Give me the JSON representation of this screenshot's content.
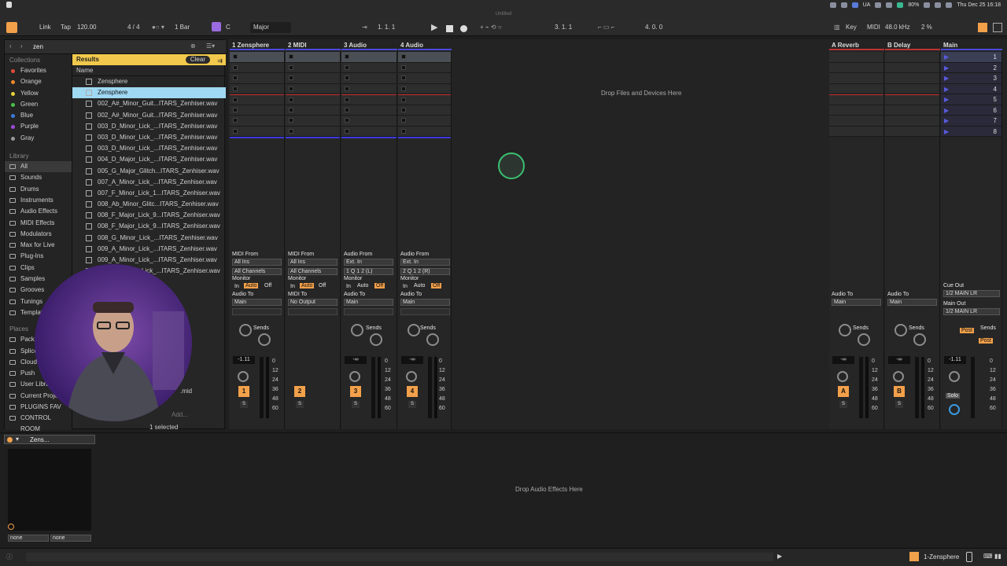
{
  "system": {
    "menubar_right": [
      "UA",
      "80%",
      "Thu Dec 25 16:18"
    ]
  },
  "window": {
    "title": "Untitled"
  },
  "transport": {
    "link": "Link",
    "tap": "Tap",
    "tempo": "120.00",
    "signature": "4 / 4",
    "quantize": "1 Bar",
    "key": "C",
    "scale": "Major",
    "position": "1.   1.   1",
    "loop_start": "3.   1.   1",
    "loop_length": "4.   0.   0",
    "key_label": "Key",
    "midi_label": "MIDI",
    "sample_rate": "48.0 kHz",
    "cpu": "2 %"
  },
  "browser": {
    "search_value": "zen",
    "collections_label": "Collections",
    "collections": [
      {
        "label": "Favorites",
        "color": "#e04a3a"
      },
      {
        "label": "Orange",
        "color": "#f08a2a"
      },
      {
        "label": "Yellow",
        "color": "#e8d23a"
      },
      {
        "label": "Green",
        "color": "#4ac04a"
      },
      {
        "label": "Blue",
        "color": "#3a7ae0"
      },
      {
        "label": "Purple",
        "color": "#a04ad8"
      },
      {
        "label": "Gray",
        "color": "#9a9a9a"
      }
    ],
    "library_label": "Library",
    "library": [
      "All",
      "Sounds",
      "Drums",
      "Instruments",
      "Audio Effects",
      "MIDI Effects",
      "Modulators",
      "Max for Live",
      "Plug-Ins",
      "Clips",
      "Samples",
      "Grooves",
      "Tunings",
      "Templates"
    ],
    "places_label": "Places",
    "places": [
      "Packs",
      "Splice",
      "Cloud",
      "Push",
      "User Library",
      "Current Project",
      "PLUGINS FAV",
      "CONTROL ROOM"
    ],
    "results_label": "Results",
    "clear_label": "Clear",
    "name_header": "Name",
    "results": [
      "Zensphere",
      "Zensphere",
      "002_A#_Minor_Guit...ITARS_Zenhiser.wav",
      "002_A#_Minor_Guit...ITARS_Zenhiser.wav",
      "003_D_Minor_Lick_...ITARS_Zenhiser.wav",
      "003_D_Minor_Lick_...ITARS_Zenhiser.wav",
      "003_D_Minor_Lick_...ITARS_Zenhiser.wav",
      "004_D_Major_Lick_...ITARS_Zenhiser.wav",
      "005_G_Major_Glitch...ITARS_Zenhiser.wav",
      "007_A_Minor_Lick_...ITARS_Zenhiser.wav",
      "007_F_Minor_Lick_1...ITARS_Zenhiser.wav",
      "008_Ab_Minor_Glitc...ITARS_Zenhiser.wav",
      "008_F_Major_Lick_9...ITARS_Zenhiser.wav",
      "008_F_Major_Lick_9...ITARS_Zenhiser.wav",
      "008_G_Minor_Lick_...ITARS_Zenhiser.wav",
      "009_A_Minor_Lick_...ITARS_Zenhiser.wav",
      "009_A_Minor_Lick_...ITARS_Zenhiser.wav",
      "009_F#_Minor_Lick_...ITARS_Zenhiser.wav"
    ],
    "footer_selected": "1 selected",
    "footer_add": "Add...",
    "mid_fragment": ".mid"
  },
  "tracks": [
    {
      "name": "1 Zensphere",
      "input_label": "MIDI From",
      "input": "All Ins",
      "channel": "All Channels",
      "out_label": "Audio To",
      "out": "Main",
      "num": "1",
      "vol": "-1.11",
      "sends_label": "Sends",
      "has_sends": true
    },
    {
      "name": "2 MIDI",
      "input_label": "MIDI From",
      "input": "All Ins",
      "channel": "All Channels",
      "out_label": "MIDI To",
      "out": "No Output",
      "num": "2",
      "vol": "",
      "sends_label": "",
      "has_sends": false
    },
    {
      "name": "3 Audio",
      "input_label": "Audio From",
      "input": "Ext. In",
      "channel": "1 Q 1 2 (L)",
      "out_label": "Audio To",
      "out": "Main",
      "num": "3",
      "vol": "-∞",
      "sends_label": "Sends",
      "has_sends": true
    },
    {
      "name": "4 Audio",
      "input_label": "Audio From",
      "input": "Ext. In",
      "channel": "2 Q 1 2 (R)",
      "out_label": "Audio To",
      "out": "Main",
      "num": "4",
      "vol": "-∞",
      "sends_label": "Sends",
      "has_sends": true
    }
  ],
  "monitor": {
    "label": "Monitor",
    "in": "In",
    "auto": "Auto",
    "off": "Off"
  },
  "returns": [
    {
      "name": "A Reverb",
      "out_label": "Audio To",
      "out": "Main",
      "num": "A",
      "vol": "-∞",
      "sends_label": "Sends"
    },
    {
      "name": "B Delay",
      "out_label": "Audio To",
      "out": "Main",
      "num": "B",
      "vol": "-∞",
      "sends_label": "Sends"
    }
  ],
  "main": {
    "name": "Main",
    "scenes": [
      "1",
      "2",
      "3",
      "4",
      "5",
      "6",
      "7",
      "8"
    ],
    "cue_out_label": "Cue Out",
    "cue_out": "1/2 MAIN LR",
    "main_out_label": "Main Out",
    "main_out": "1/2 MAIN LR",
    "sends_label": "Sends",
    "post1": "Post",
    "post2": "Post",
    "vol": "-1.11",
    "solo": "Solo"
  },
  "meter_scale": [
    "0",
    "12",
    "24",
    "36",
    "48",
    "60"
  ],
  "solo_label": "S",
  "session_drop_text": "Drop Files and Devices Here",
  "devices": {
    "drop_text": "Drop Audio Effects Here",
    "instrument_name": "Zens...",
    "macro_select_1": "none",
    "macro_select_2": "none"
  },
  "statusbar": {
    "track_label": "1-Zensphere"
  },
  "accent": "#f2a04a",
  "selection_color": "#9fd8f2"
}
